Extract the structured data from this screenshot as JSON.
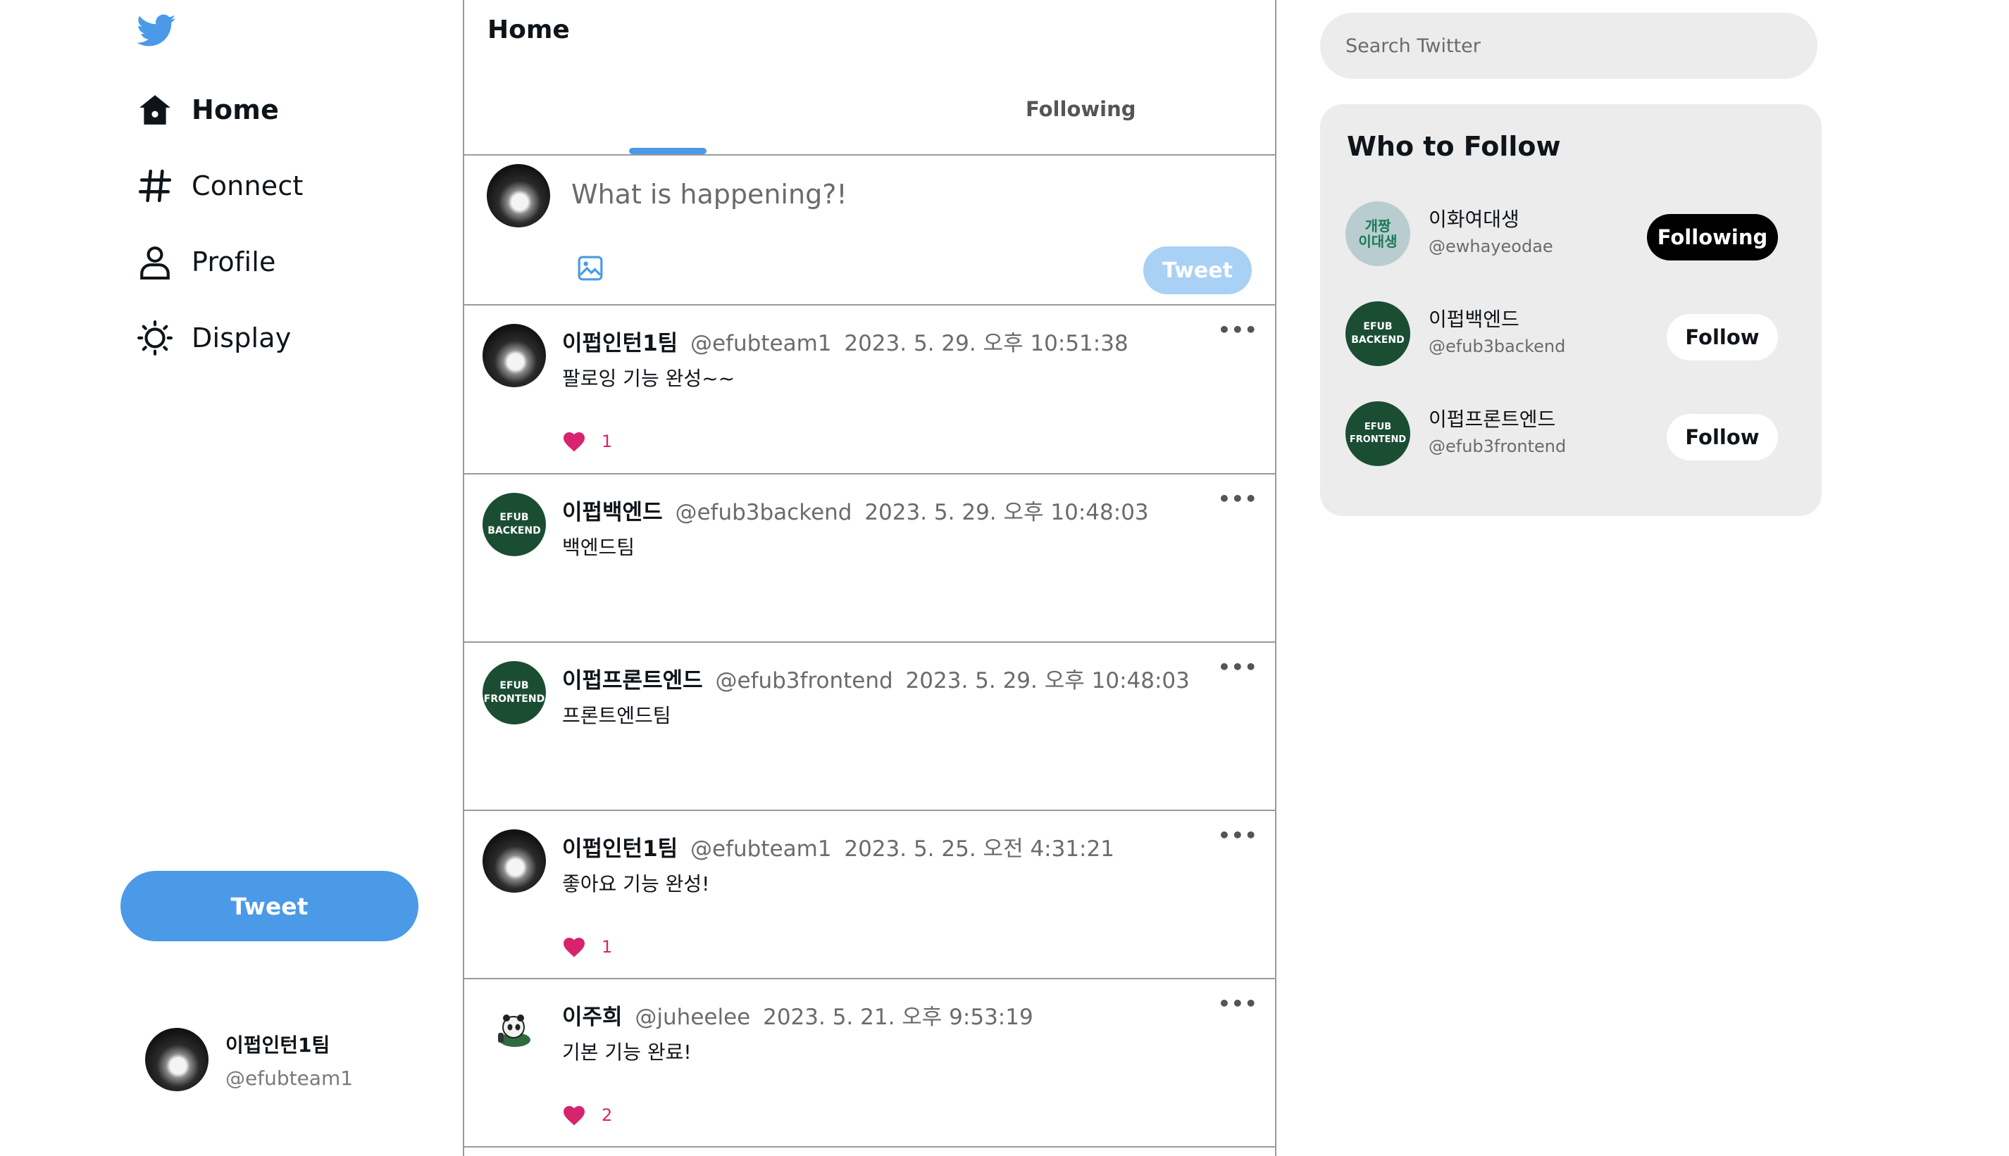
{
  "colors": {
    "brand": "#4a9ae8",
    "like": "#d8236e",
    "tweet_disabled": "#a9d0f5"
  },
  "sidebar": {
    "logo_icon": "twitter-bird-icon",
    "items": [
      {
        "label": "Home",
        "icon": "home-icon"
      },
      {
        "label": "Connect",
        "icon": "hash-icon"
      },
      {
        "label": "Profile",
        "icon": "person-icon"
      },
      {
        "label": "Display",
        "icon": "sun-icon"
      }
    ],
    "tweet_label": "Tweet",
    "user": {
      "name": "이펍인턴1팀",
      "handle": "@efubteam1"
    }
  },
  "main": {
    "title": "Home",
    "tabs": [
      {
        "label": ""
      },
      {
        "label": "Following"
      }
    ],
    "composer": {
      "placeholder": "What is happening?!",
      "tweet_label": "Tweet"
    },
    "tweets": [
      {
        "name": "이펍인턴1팀",
        "handle": "@efubteam1",
        "time": "2023. 5. 29. 오후 10:51:38",
        "text": "팔로잉 기능 완성~~",
        "likes": "1",
        "more": "•••"
      },
      {
        "name": "이펍백엔드",
        "handle": "@efub3backend",
        "time": "2023. 5. 29. 오후 10:48:03",
        "text": "백엔드팀",
        "likes": "",
        "more": "•••",
        "avatar_text": [
          "EFUB",
          "BACKEND"
        ]
      },
      {
        "name": "이펍프론트엔드",
        "handle": "@efub3frontend",
        "time": "2023. 5. 29. 오후 10:48:03",
        "text": "프론트엔드팀",
        "likes": "",
        "more": "•••",
        "avatar_text": [
          "EFUB",
          "FRONTEND"
        ]
      },
      {
        "name": "이펍인턴1팀",
        "handle": "@efubteam1",
        "time": "2023. 5. 25. 오전 4:31:21",
        "text": "좋아요 기능 완성!",
        "likes": "1",
        "more": "•••"
      },
      {
        "name": "이주희",
        "handle": "@juheelee",
        "time": "2023. 5. 21. 오후 9:53:19",
        "text": "기본 기능 완료!",
        "likes": "2",
        "more": "•••"
      }
    ]
  },
  "right": {
    "search_placeholder": "Search Twitter",
    "who_to_follow": {
      "title": "Who to Follow",
      "users": [
        {
          "name": "이화여대생",
          "handle": "@ewhayeodae",
          "button": "Following",
          "avatar_text": [
            "개짱",
            "이대생"
          ]
        },
        {
          "name": "이펍백엔드",
          "handle": "@efub3backend",
          "button": "Follow",
          "avatar_text": [
            "EFUB",
            "BACKEND"
          ]
        },
        {
          "name": "이펍프론트엔드",
          "handle": "@efub3frontend",
          "button": "Follow",
          "avatar_text": [
            "EFUB",
            "FRONTEND"
          ]
        }
      ]
    }
  }
}
